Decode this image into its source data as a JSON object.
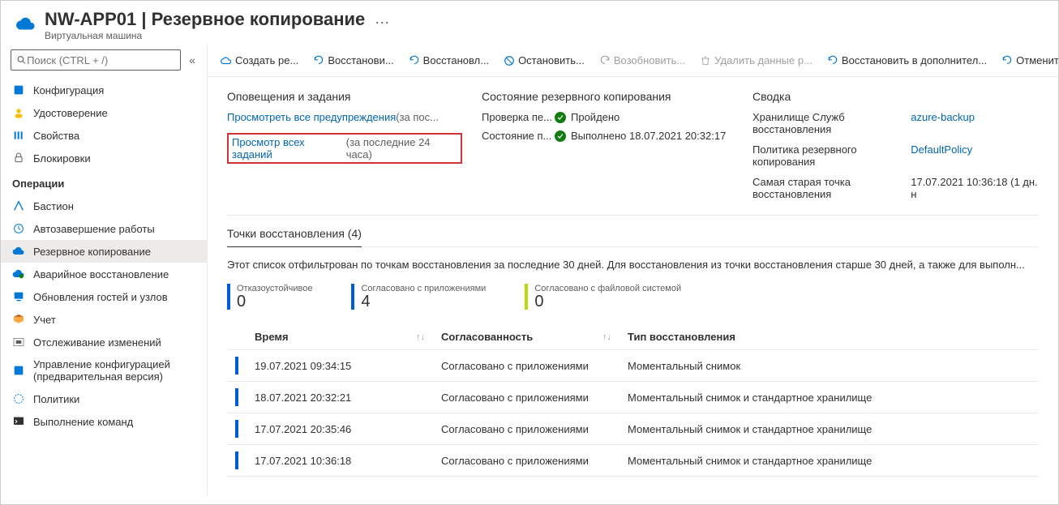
{
  "header": {
    "title": "NW-APP01 | Резервное копирование",
    "subtitle": "Виртуальная машина"
  },
  "search": {
    "placeholder": "Поиск (CTRL + /)"
  },
  "collapse_glyph": "«",
  "sidebar": {
    "section1": [
      {
        "label": "Конфигурация"
      },
      {
        "label": "Удостоверение"
      },
      {
        "label": "Свойства"
      },
      {
        "label": "Блокировки"
      }
    ],
    "ops_title": "Операции",
    "section2": [
      {
        "label": "Бастион"
      },
      {
        "label": "Автозавершение работы"
      },
      {
        "label": "Резервное копирование",
        "selected": true
      },
      {
        "label": "Аварийное восстановление"
      },
      {
        "label": "Обновления гостей и узлов"
      },
      {
        "label": "Учет"
      },
      {
        "label": "Отслеживание изменений"
      },
      {
        "label": "Управление конфигурацией (предварительная версия)"
      },
      {
        "label": "Политики"
      },
      {
        "label": "Выполнение команд"
      }
    ]
  },
  "toolbar": {
    "create": "Создать ре...",
    "restore": "Восстанови...",
    "restored": "Восстановл...",
    "stop": "Остановить...",
    "resume": "Возобновить...",
    "delete": "Удалить данные р...",
    "restore_ext": "Восстановить в дополнител...",
    "cancel": "Отменить ..."
  },
  "panels": {
    "alerts": {
      "title": "Оповещения и задания",
      "view_alerts_link": "Просмотреть все предупреждения",
      "view_alerts_suffix": " (за пос...",
      "view_jobs_link": "Просмотр всех заданий",
      "view_jobs_suffix": " (за последние 24 часа)"
    },
    "backup_status": {
      "title": "Состояние резервного копирования",
      "check_label": "Проверка пе...",
      "check_value": "Пройдено",
      "state_label": "Состояние п...",
      "state_value": "Выполнено 18.07.2021 20:32:17"
    },
    "summary": {
      "title": "Сводка",
      "vault_label": "Хранилище Служб восстановления",
      "vault_value": "azure-backup",
      "policy_label": "Политика резервного копирования",
      "policy_value": "DefaultPolicy",
      "oldest_label": "Самая старая точка восстановления",
      "oldest_value": "17.07.2021 10:36:18 (1 дн. н"
    }
  },
  "restore_points": {
    "title": "Точки восстановления (4)",
    "desc": "Этот список отфильтрован по точкам восстановления за последние 30 дней. Для восстановления из точки восстановления старше 30 дней, а также для выполн...",
    "stats": {
      "crash": {
        "label": "Отказоустойчивое",
        "value": "0"
      },
      "app": {
        "label": "Согласовано с приложениями",
        "value": "4"
      },
      "file": {
        "label": "Согласовано с файловой системой",
        "value": "0"
      }
    },
    "columns": {
      "time": "Время",
      "consistency": "Согласованность",
      "type": "Тип восстановления"
    },
    "rows": [
      {
        "time": "19.07.2021 09:34:15",
        "consistency": "Согласовано с приложениями",
        "type": "Моментальный снимок"
      },
      {
        "time": "18.07.2021 20:32:21",
        "consistency": "Согласовано с приложениями",
        "type": "Моментальный снимок и стандартное хранилище"
      },
      {
        "time": "17.07.2021 20:35:46",
        "consistency": "Согласовано с приложениями",
        "type": "Моментальный снимок и стандартное хранилище"
      },
      {
        "time": "17.07.2021 10:36:18",
        "consistency": "Согласовано с приложениями",
        "type": "Моментальный снимок и стандартное хранилище"
      }
    ]
  }
}
